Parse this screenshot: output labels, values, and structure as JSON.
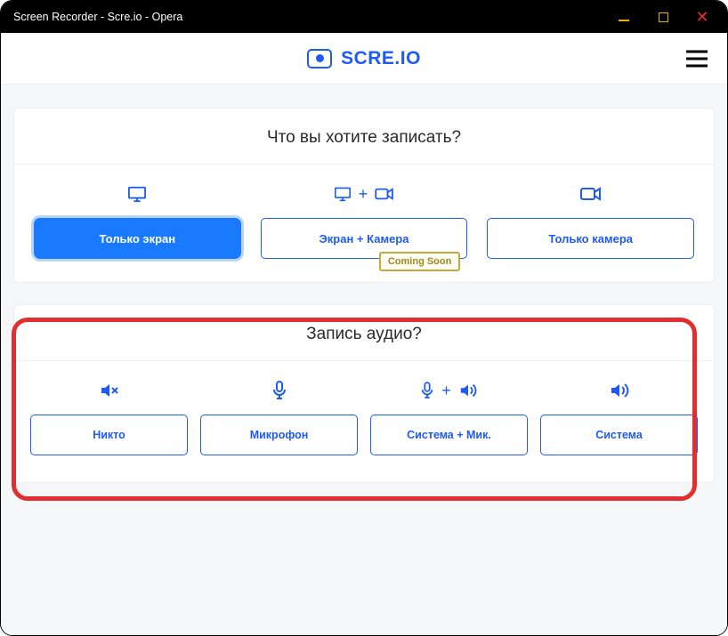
{
  "window": {
    "title": "Screen Recorder - Scre.io - Opera"
  },
  "brand": {
    "name": "SCRE.IO"
  },
  "section_record": {
    "title": "Что вы хотите записать?",
    "options": [
      {
        "label": "Только экран"
      },
      {
        "label": "Экран + Камера",
        "badge": "Coming Soon"
      },
      {
        "label": "Только камера"
      }
    ]
  },
  "section_audio": {
    "title": "Запись аудио?",
    "options": [
      {
        "label": "Никто"
      },
      {
        "label": "Микрофон"
      },
      {
        "label": "Система + Мик."
      },
      {
        "label": "Система"
      }
    ]
  }
}
